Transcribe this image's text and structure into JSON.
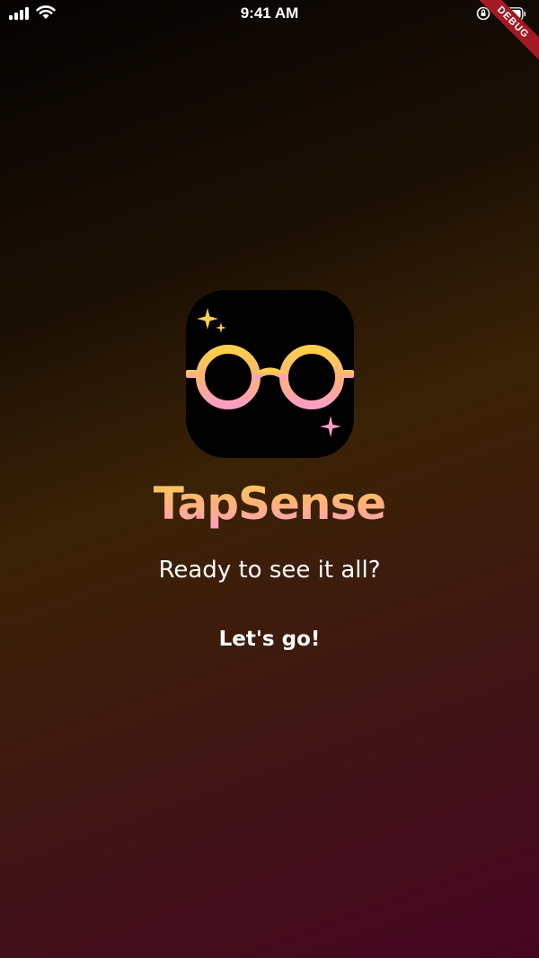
{
  "status_bar": {
    "time": "9:41 AM",
    "icons": [
      "signal-icon",
      "wifi-icon",
      "orientation-lock-icon",
      "battery-icon"
    ]
  },
  "debug_banner": {
    "label": "DEBUG"
  },
  "app": {
    "title": "TapSense",
    "tagline": "Ready to see it all?",
    "cta_label": "Let's go!",
    "logo_icon": "glasses-icon"
  },
  "colors": {
    "title_gradient": [
      "#ffcf4a",
      "#ffb27a",
      "#ff9ec4"
    ],
    "debug_banner": "#a31a24",
    "background_top": "#050302",
    "background_bottom": "#470420"
  }
}
